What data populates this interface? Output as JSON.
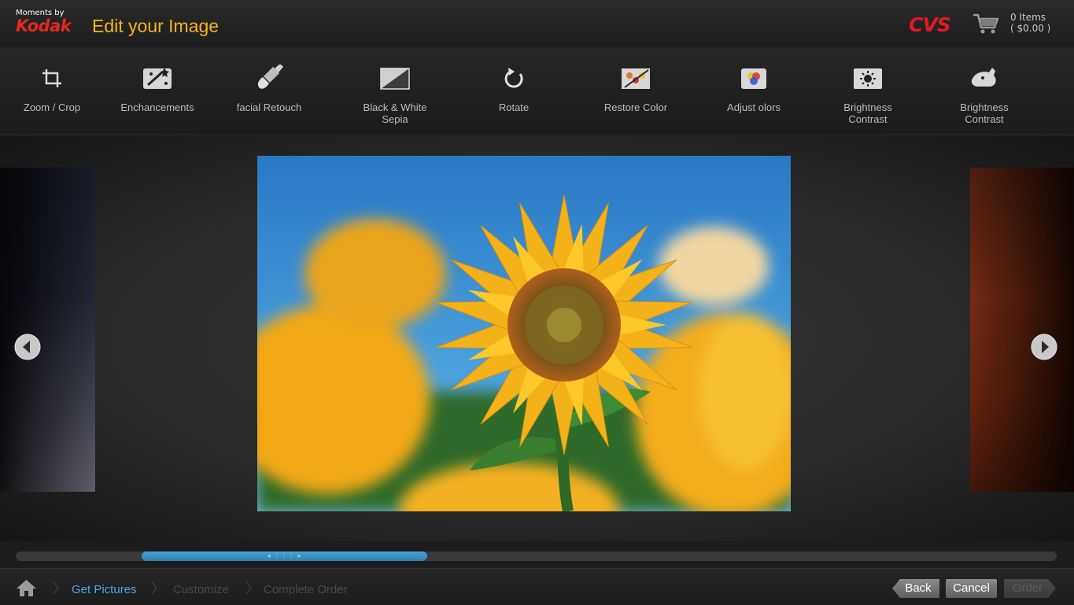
{
  "header": {
    "brand_small": "Moments by",
    "brand_logo": "Kodak",
    "title": "Edit your Image",
    "store_logo": "CVS",
    "cart_items": "0 Items",
    "cart_total": "( $0.00 )",
    "cart_icon": "shopping-cart-icon"
  },
  "toolbar": {
    "tools": [
      {
        "label": "Zoom / Crop",
        "sub": "",
        "icon": "crop-icon"
      },
      {
        "label": "Enchancements",
        "sub": "",
        "icon": "magic-wand-icon"
      },
      {
        "label": "facial  Retouch",
        "sub": "",
        "icon": "brush-icon"
      },
      {
        "label": "Black & White",
        "sub": "Sepia",
        "icon": "black-white-icon"
      },
      {
        "label": "Rotate",
        "sub": "",
        "icon": "rotate-icon"
      },
      {
        "label": "Restore Color",
        "sub": "",
        "icon": "restore-color-icon"
      },
      {
        "label": "Adjust olors",
        "sub": "",
        "icon": "adjust-colors-icon"
      },
      {
        "label": "Brightness",
        "sub": "Contrast",
        "icon": "brightness-icon"
      },
      {
        "label": "Brightness",
        "sub": "Contrast",
        "icon": "red-eye-icon"
      }
    ]
  },
  "stage": {
    "prev_icon": "chevron-left-icon",
    "next_icon": "chevron-right-icon"
  },
  "scrollbar": {
    "position_fraction": 0.12,
    "visible_fraction": 0.27,
    "grip": "◂ ⋮⋮⋮ ▸"
  },
  "footer": {
    "home_icon": "home-icon",
    "crumbs": [
      "Get Pictures",
      "Customize",
      "Complete Order"
    ],
    "back": "Back",
    "cancel": "Cancel",
    "order": "Order"
  },
  "colors": {
    "accent": "#f5b51e",
    "brand_red": "#e5281f",
    "active_crumb": "#4aa8e0",
    "scroll_thumb": "#3b8fc4"
  }
}
